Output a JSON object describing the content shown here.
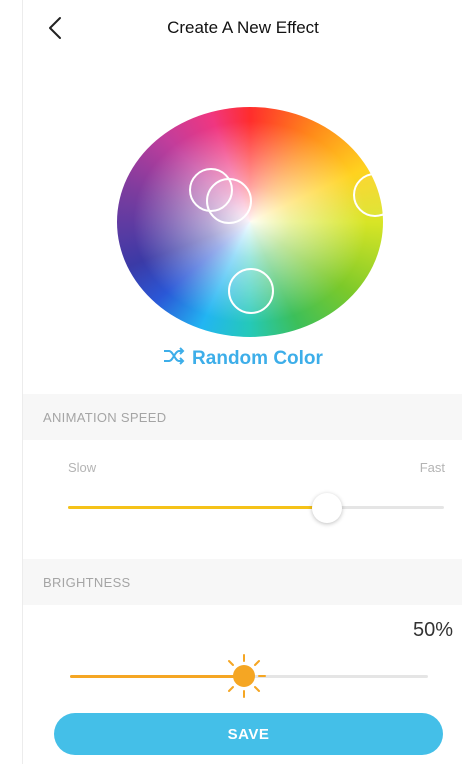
{
  "header": {
    "title": "Create A New Effect",
    "back_icon": "chevron-left-icon"
  },
  "color_wheel": {
    "selected_colors": 4
  },
  "random_color": {
    "label": "Random Color",
    "icon": "shuffle-icon",
    "color": "#3daee9"
  },
  "animation_speed": {
    "section_label": "ANIMATION SPEED",
    "min_label": "Slow",
    "max_label": "Fast",
    "value_fraction": 0.69,
    "track_active_color": "#f5c218",
    "track_inactive_color": "#e5e5e5"
  },
  "brightness": {
    "section_label": "BRIGHTNESS",
    "value_text": "50%",
    "value_fraction": 0.5,
    "icon": "sun-icon",
    "accent_color": "#f5a623"
  },
  "save": {
    "label": "SAVE",
    "color": "#44bfe8"
  }
}
